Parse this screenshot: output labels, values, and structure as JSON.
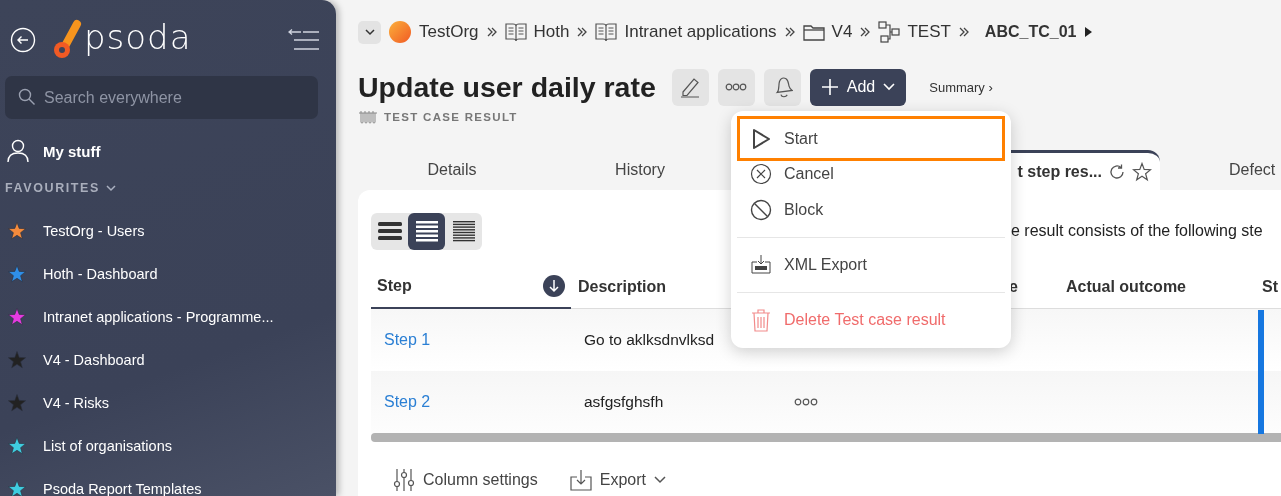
{
  "sidebar": {
    "logo_text": "psoda",
    "search": {
      "placeholder": "Search everywhere"
    },
    "my_stuff": "My stuff",
    "favourites_heading": "FAVOURITES",
    "favourites": [
      {
        "label": "TestOrg - Users",
        "color": "#f58b3c"
      },
      {
        "label": "Hoth - Dashboard",
        "color": "#2f8fe8"
      },
      {
        "label": "Intranet applications - Programme...",
        "color": "#e53be0"
      },
      {
        "label": "V4 - Dashboard",
        "color": "#222222"
      },
      {
        "label": "V4 - Risks",
        "color": "#222222"
      },
      {
        "label": "List of organisations",
        "color": "#3fcde0"
      },
      {
        "label": "Psoda Report Templates",
        "color": "#3fcde0"
      }
    ]
  },
  "breadcrumb": [
    {
      "label": "TestOrg",
      "kind": "org"
    },
    {
      "label": "Hoth",
      "kind": "book"
    },
    {
      "label": "Intranet applications",
      "kind": "book"
    },
    {
      "label": "V4",
      "kind": "folder"
    },
    {
      "label": "TEST",
      "kind": "flow"
    },
    {
      "label": "ABC_TC_01",
      "kind": "current"
    }
  ],
  "page": {
    "title": "Update user daily rate",
    "type_label": "TEST CASE RESULT",
    "add_button": "Add",
    "summary_link": "Summary ›"
  },
  "tabs": [
    {
      "label": "Details",
      "selected": false
    },
    {
      "label": "History",
      "selected": false
    },
    {
      "label": "t step res...",
      "selected": true
    },
    {
      "label": "Defect",
      "selected": false
    }
  ],
  "view_modes": [
    {
      "kind": "large",
      "selected": false
    },
    {
      "kind": "medium",
      "selected": true
    },
    {
      "kind": "small",
      "selected": false
    }
  ],
  "intro": "e result consists of the following ste",
  "table": {
    "columns": [
      "Step",
      "Description",
      "e",
      "Actual outcome",
      "St"
    ],
    "rows": [
      {
        "step": "Step 1",
        "description": "Go to aklksdnvlksd",
        "more": false
      },
      {
        "step": "Step 2",
        "description": "asfgsfghsfh",
        "more": true
      }
    ]
  },
  "footer": [
    {
      "label": "Column settings",
      "kind": "settings"
    },
    {
      "label": "Export",
      "kind": "export"
    }
  ],
  "menu": [
    [
      {
        "label": "Start",
        "kind": "start",
        "selected": true
      },
      {
        "label": "Cancel",
        "kind": "cancel",
        "selected": false
      },
      {
        "label": "Block",
        "kind": "block",
        "selected": false
      }
    ],
    [
      {
        "label": "XML Export",
        "kind": "xml",
        "selected": false
      }
    ],
    [
      {
        "label": "Delete Test case result",
        "kind": "delete",
        "selected": false
      }
    ]
  ]
}
